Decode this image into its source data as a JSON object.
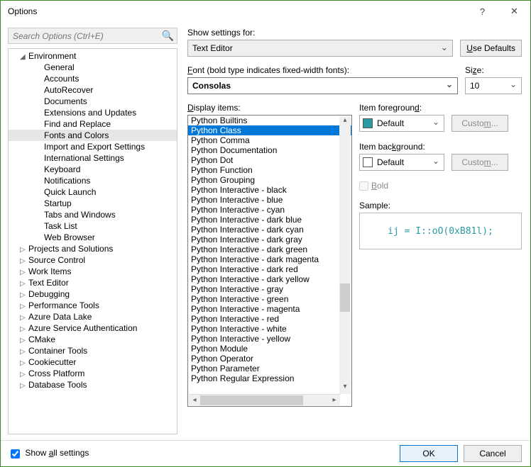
{
  "window": {
    "title": "Options",
    "help": "?",
    "close": "✕"
  },
  "search": {
    "placeholder": "Search Options (Ctrl+E)"
  },
  "tree": {
    "environment": {
      "label": "Environment",
      "expanded": true,
      "children": [
        "General",
        "Accounts",
        "AutoRecover",
        "Documents",
        "Extensions and Updates",
        "Find and Replace",
        "Fonts and Colors",
        "Import and Export Settings",
        "International Settings",
        "Keyboard",
        "Notifications",
        "Quick Launch",
        "Startup",
        "Tabs and Windows",
        "Task List",
        "Web Browser"
      ],
      "selected": "Fonts and Colors"
    },
    "collapsed": [
      "Projects and Solutions",
      "Source Control",
      "Work Items",
      "Text Editor",
      "Debugging",
      "Performance Tools",
      "Azure Data Lake",
      "Azure Service Authentication",
      "CMake",
      "Container Tools",
      "Cookiecutter",
      "Cross Platform",
      "Database Tools"
    ]
  },
  "panel": {
    "show_settings_label": "Show settings for:",
    "show_settings_value": "Text Editor",
    "use_defaults": "Use Defaults",
    "font_label": "Font (bold type indicates fixed-width fonts):",
    "font_value": "Consolas",
    "size_label": "Size:",
    "size_value": "10",
    "display_items_label": "Display items:",
    "display_items": [
      "Python Builtins",
      "Python Class",
      "Python Comma",
      "Python Documentation",
      "Python Dot",
      "Python Function",
      "Python Grouping",
      "Python Interactive - black",
      "Python Interactive - blue",
      "Python Interactive - cyan",
      "Python Interactive - dark blue",
      "Python Interactive - dark cyan",
      "Python Interactive - dark gray",
      "Python Interactive - dark green",
      "Python Interactive - dark magenta",
      "Python Interactive - dark red",
      "Python Interactive - dark yellow",
      "Python Interactive - gray",
      "Python Interactive - green",
      "Python Interactive - magenta",
      "Python Interactive - red",
      "Python Interactive - white",
      "Python Interactive - yellow",
      "Python Module",
      "Python Operator",
      "Python Parameter",
      "Python Regular Expression"
    ],
    "display_selected": "Python Class",
    "item_fg_label": "Item foreground:",
    "item_fg_value": "Default",
    "item_fg_color": "#2b9aa3",
    "item_bg_label": "Item background:",
    "item_bg_value": "Default",
    "item_bg_color": "#ffffff",
    "custom": "Custom...",
    "bold_label": "Bold",
    "sample_label": "Sample:",
    "sample_text": "ij = I::oO(0xB81l);"
  },
  "footer": {
    "show_all": "Show all settings",
    "ok": "OK",
    "cancel": "Cancel"
  }
}
